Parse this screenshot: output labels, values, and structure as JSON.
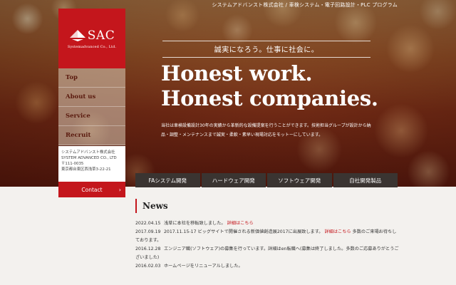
{
  "header": {
    "top_strip": "システムアドバンスト株式会社 / 車検システム・電子回路設計・PLC プログラム"
  },
  "logo": {
    "mark": "SAC",
    "company": "Systemadvanced Co., Ltd."
  },
  "nav": {
    "items": [
      {
        "label": "Top"
      },
      {
        "label": "About us"
      },
      {
        "label": "Service"
      },
      {
        "label": "Recruit"
      }
    ],
    "contact_label": "Contact"
  },
  "address": {
    "name_ja": "システムアドバンスト株式会社",
    "name_en": "SYSTEM ADVANCED CO., LTD",
    "postal": "〒111-0035",
    "street": "東京都台東区西浅草3-22-21"
  },
  "hero": {
    "tagline": "誠実になろう。仕事に社会に。",
    "headline_1": "Honest work.",
    "headline_2": "Honest companies.",
    "description": "当社は車検設備設計30年の実績から革新的な設備提案を行うことができます。技術担当グループが設計から納品・調整・メンテナンスまで誠実・柔軟・素早い現場対応をモットーにしています。"
  },
  "services": {
    "tabs": [
      {
        "label": "FAシステム開発"
      },
      {
        "label": "ハードウェア開発"
      },
      {
        "label": "ソフトウェア開発"
      },
      {
        "label": "自社開発製品"
      }
    ]
  },
  "news": {
    "title": "News",
    "items": [
      {
        "date": "2022.04.15",
        "text": "浅草に本社を移転致しました。",
        "link": "詳細はこちら",
        "tail": ""
      },
      {
        "date": "2017.09.19",
        "text": "2017.11.15-17 ビッグサイトで開催される新価値創造展2017に出展致します。",
        "link": "詳細はこちら",
        "tail": "多数のご来場お待ちしております。"
      },
      {
        "date": "2016.12.28",
        "text": "エンジニア職(ソフトウェア)の募集を行っています。詳細はen転職へ(募集は終了しました。多数のご応募ありがとうございました)",
        "link": "",
        "tail": ""
      },
      {
        "date": "2016.02.03",
        "text": "ホームページをリニューアルしました。",
        "link": "",
        "tail": ""
      }
    ]
  },
  "colors": {
    "brand_red": "#c4161c",
    "tab_dark": "#3a3431"
  }
}
